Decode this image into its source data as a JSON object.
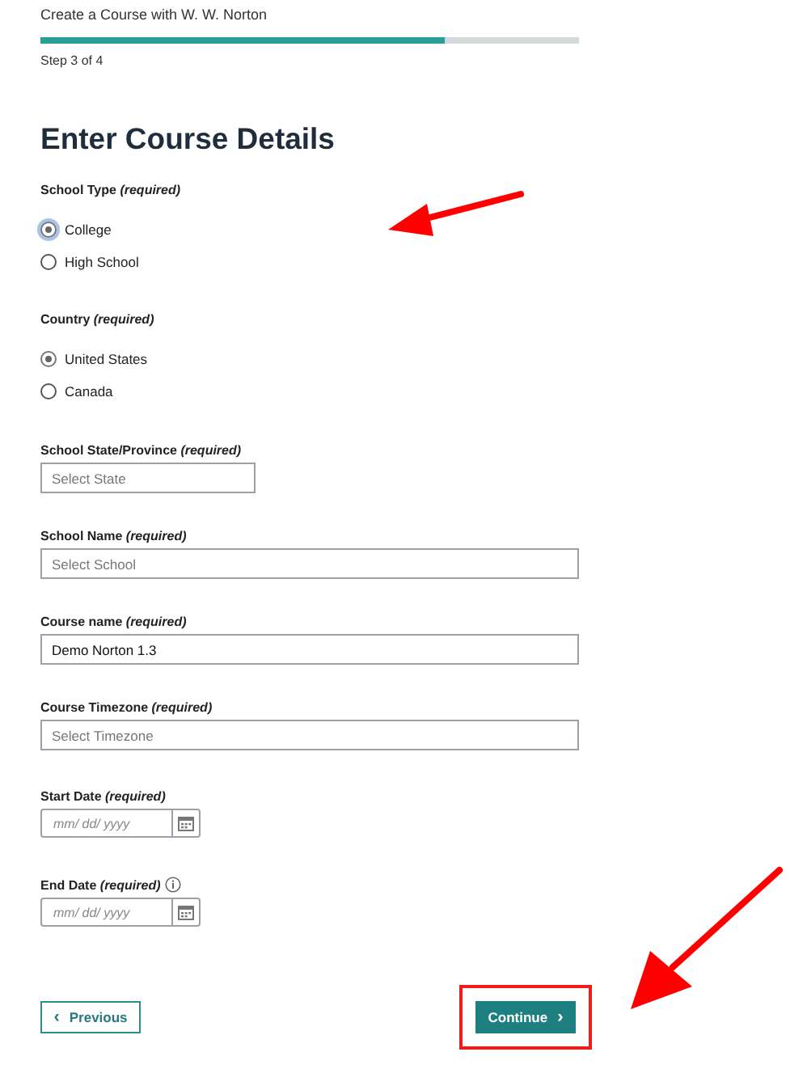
{
  "header": {
    "title": "Create a Course with W. W. Norton",
    "progress": {
      "level": 0.75
    },
    "step": "Step 3 of 4"
  },
  "heading": "Enter Course Details",
  "fields": [
    {
      "kind": "radio",
      "label": "School Type *(required)*",
      "options": [
        {
          "label": "College",
          "selected": true,
          "focused": true
        },
        {
          "label": "High School",
          "selected": false,
          "focused": false
        }
      ]
    },
    {
      "kind": "radio",
      "label": "Country *(required)*",
      "options": [
        {
          "label": "United States",
          "selected": true,
          "focused": false
        },
        {
          "label": "Canada",
          "selected": false,
          "focused": false
        }
      ]
    },
    {
      "kind": "select",
      "label": "School State/Province *(required)*",
      "placeholder": "Select State"
    },
    {
      "kind": "select",
      "label": "School Name *(required)*",
      "placeholder": "Select School"
    },
    {
      "kind": "text",
      "label": "Course name *(required)*",
      "value": "Demo Norton 1.3"
    },
    {
      "kind": "select",
      "label": "Course Timezone *(required)*",
      "placeholder": "Select Timezone"
    },
    {
      "kind": "date",
      "label": "Start Date *(required)*",
      "placeholder": "mm/ dd/ yyyy",
      "info": false
    },
    {
      "kind": "date",
      "label": "End Date *(required)*",
      "placeholder": "mm/ dd/ yyyy",
      "info": true
    }
  ],
  "buttons": {
    "previous_icon": "‹",
    "previous": "Previous",
    "continue": "Continue",
    "continue_icon": "›",
    "continue_highlighted": true
  },
  "annotations": [
    {
      "kind": "arrow"
    },
    {
      "kind": "arrow"
    }
  ]
}
